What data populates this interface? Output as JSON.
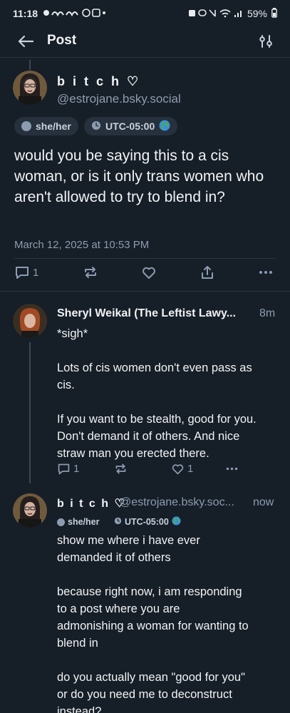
{
  "status_bar": {
    "time": "11:18",
    "battery": "59%"
  },
  "header": {
    "title": "Post"
  },
  "post": {
    "author_name": "b i t c h ♡",
    "handle": "@estrojane.bsky.social",
    "pronouns": "she/her",
    "timezone": "UTC-05:00",
    "text": "would you be saying this to a cis woman, or is it only trans women who aren't allowed to try to blend in?",
    "timestamp": "March 12, 2025 at 10:53 PM",
    "reply_count": "1"
  },
  "replies": [
    {
      "author_name": "Sheryl Weikal (The Leftist Lawy...",
      "time": "8m",
      "lines": [
        "*sigh*",
        "",
        "Lots of cis women don't even pass as cis.",
        "",
        "If you want to be stealth, good for you. Don't demand it of others. And nice straw man you erected there."
      ],
      "reply_count": "1",
      "like_count": "1"
    },
    {
      "author_name": "b i t c h ♡",
      "handle": "@estrojane.bsky.soc...",
      "time": "now",
      "pronouns": "she/her",
      "timezone": "UTC-05:00",
      "text": "show me where i have ever demanded it of others\n\nbecause right now, i am responding to a post where you are admonishing a woman for wanting to blend in\n\ndo you actually mean \"good for you\" or do you need me to deconstruct instead?"
    }
  ],
  "colors": {
    "background": "#161e27",
    "muted": "#8c9cb0",
    "pill": "#26313d"
  }
}
